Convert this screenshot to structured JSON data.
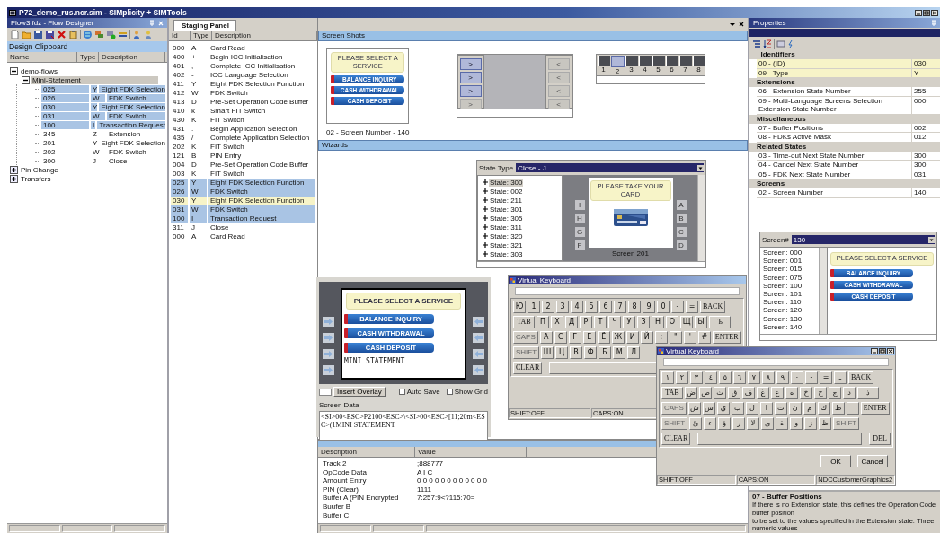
{
  "app_title": "P72_demo_rus.ncr.sim - SIMplicity + SIMTools",
  "flow_designer": {
    "title": "Flow3.fdz - Flow Designer",
    "clipboard_title": "Design Clipboard",
    "columns": [
      "Name",
      "Type",
      "Description"
    ],
    "tree": [
      {
        "name": "demo-flows",
        "expanded": true,
        "selected": false,
        "children": [
          {
            "name": "Mini-Statement",
            "expanded": true,
            "selected": true,
            "children": [
              {
                "name": "025",
                "type": "Y",
                "description": "Eight FDK Selection",
                "selected": true
              },
              {
                "name": "026",
                "type": "W",
                "description": "FDK Switch",
                "selected": true
              },
              {
                "name": "030",
                "type": "Y",
                "description": "Eight FDK Selection",
                "selected": true
              },
              {
                "name": "031",
                "type": "W",
                "description": "FDK Switch",
                "selected": true
              },
              {
                "name": "100",
                "type": "I",
                "description": "Transaction Request",
                "selected": true
              },
              {
                "name": "345",
                "type": "Z",
                "description": "Extension",
                "selected": false
              },
              {
                "name": "201",
                "type": "Y",
                "description": "Eight FDK Selection",
                "selected": false
              },
              {
                "name": "202",
                "type": "W",
                "description": "FDK Switch",
                "selected": false
              },
              {
                "name": "300",
                "type": "J",
                "description": "Close",
                "selected": false
              }
            ]
          }
        ]
      },
      {
        "name": "Pin Change",
        "expanded": false,
        "selected": false
      },
      {
        "name": "Transfers",
        "expanded": false,
        "selected": false
      }
    ]
  },
  "staging": {
    "tab": "Staging Panel",
    "columns": [
      "Id",
      "Type",
      "Description"
    ],
    "rows": [
      {
        "id": "000",
        "type": "A",
        "description": "Card Read",
        "selected": false,
        "current": false
      },
      {
        "id": "400",
        "type": "+",
        "description": "Begin ICC Initialisation",
        "selected": false,
        "current": false
      },
      {
        "id": "401",
        "type": ",",
        "description": "Complete ICC Initialisation",
        "selected": false,
        "current": false
      },
      {
        "id": "402",
        "type": "-",
        "description": "ICC Language Selection",
        "selected": false,
        "current": false
      },
      {
        "id": "411",
        "type": "Y",
        "description": "Eight FDK Selection Function",
        "selected": false,
        "current": false
      },
      {
        "id": "412",
        "type": "W",
        "description": "FDK Switch",
        "selected": false,
        "current": false
      },
      {
        "id": "413",
        "type": "D",
        "description": "Pre-Set Operation Code Buffer",
        "selected": false,
        "current": false
      },
      {
        "id": "410",
        "type": "k",
        "description": "Smart FIT Switch",
        "selected": false,
        "current": false
      },
      {
        "id": "430",
        "type": "K",
        "description": "FIT Switch",
        "selected": false,
        "current": false
      },
      {
        "id": "431",
        "type": ".",
        "description": "Begin Application Selection",
        "selected": false,
        "current": false
      },
      {
        "id": "435",
        "type": "/",
        "description": "Complete Application Selection",
        "selected": false,
        "current": false
      },
      {
        "id": "202",
        "type": "K",
        "description": "FIT Switch",
        "selected": false,
        "current": false
      },
      {
        "id": "121",
        "type": "B",
        "description": "PIN Entry",
        "selected": false,
        "current": false
      },
      {
        "id": "004",
        "type": "D",
        "description": "Pre-Set Operation Code Buffer",
        "selected": false,
        "current": false
      },
      {
        "id": "003",
        "type": "K",
        "description": "FIT Switch",
        "selected": false,
        "current": false
      },
      {
        "id": "025",
        "type": "Y",
        "description": "Eight FDK Selection Function",
        "selected": true,
        "current": false
      },
      {
        "id": "026",
        "type": "W",
        "description": "FDK Switch",
        "selected": true,
        "current": false
      },
      {
        "id": "030",
        "type": "Y",
        "description": "Eight FDK Selection Function",
        "selected": true,
        "current": true
      },
      {
        "id": "031",
        "type": "W",
        "description": "FDK Switch",
        "selected": true,
        "current": false
      },
      {
        "id": "100",
        "type": "I",
        "description": "Transaction Request",
        "selected": true,
        "current": false
      },
      {
        "id": "311",
        "type": "J",
        "description": "Close",
        "selected": false,
        "current": false
      },
      {
        "id": "000",
        "type": "A",
        "description": "Card Read",
        "selected": false,
        "current": false
      }
    ]
  },
  "screen_shots": {
    "title": "Screen Shots",
    "screen": {
      "prompt": "PLEASE SELECT A SERVICE",
      "buttons": [
        "BALANCE INQUIRY",
        "CASH WITHDRAWAL",
        "CASH DEPOSIT"
      ],
      "caption": "02 - Screen Number - 140"
    },
    "fdk_left": [
      {
        "label": ">",
        "active": true
      },
      {
        "label": ">",
        "active": true
      },
      {
        "label": ">",
        "active": true
      },
      {
        "label": ">",
        "active": false
      }
    ],
    "fdk_right": [
      {
        "label": "<",
        "active": false
      },
      {
        "label": "<",
        "active": false
      },
      {
        "label": "<",
        "active": false
      },
      {
        "label": "<",
        "active": false
      }
    ],
    "positions": [
      {
        "label": "1",
        "selected": false
      },
      {
        "label": "2",
        "selected": true
      },
      {
        "label": "3",
        "selected": false
      },
      {
        "label": "4",
        "selected": false
      },
      {
        "label": "5",
        "selected": false
      },
      {
        "label": "6",
        "selected": false
      },
      {
        "label": "7",
        "selected": false
      },
      {
        "label": "8",
        "selected": false
      }
    ]
  },
  "wizards": {
    "title": "Wizards"
  },
  "state_wizard": {
    "label": "State Type",
    "value": "Close - J",
    "states": [
      {
        "label": "State: 300",
        "selected": true
      },
      {
        "label": "State: 002",
        "selected": false
      },
      {
        "label": "State: 211",
        "selected": false
      },
      {
        "label": "State: 301",
        "selected": false
      },
      {
        "label": "State: 305",
        "selected": false
      },
      {
        "label": "State: 311",
        "selected": false
      },
      {
        "label": "State: 320",
        "selected": false
      },
      {
        "label": "State: 321",
        "selected": false
      },
      {
        "label": "State: 303",
        "selected": false
      }
    ],
    "prompt": "PLEASE TAKE YOUR CARD",
    "left_fdks": [
      "I",
      "H",
      "G",
      "F"
    ],
    "right_fdks": [
      "A",
      "B",
      "C",
      "D"
    ],
    "caption": "Screen 201"
  },
  "atm_editor": {
    "prompt": "PLEASE SELECT A SERVICE",
    "buttons": [
      "BALANCE INQUIRY",
      "CASH WITHDRAWAL",
      "CASH DEPOSIT"
    ],
    "footer": "MINI STATEMENT",
    "overlay_button": "Insert Overlay",
    "options": [
      {
        "label": "Auto Save",
        "checked": false
      },
      {
        "label": "Show Grid",
        "checked": false
      }
    ],
    "data_label": "Screen Data",
    "data": "<SI>00<ESC>P2100<ESC>\\<SI>00<ESC>[11;20m<ESC>(1MINI STATEMENT"
  },
  "keyboard_russian": {
    "title": "Virtual Keyboard",
    "rows": [
      {
        "keys": [
          {
            "label": "Ю",
            "kind": "char"
          },
          {
            "label": "1",
            "kind": "char"
          },
          {
            "label": "2",
            "kind": "char"
          },
          {
            "label": "3",
            "kind": "char"
          },
          {
            "label": "4",
            "kind": "char"
          },
          {
            "label": "5",
            "kind": "char"
          },
          {
            "label": "6",
            "kind": "char"
          },
          {
            "label": "7",
            "kind": "char"
          },
          {
            "label": "8",
            "kind": "char"
          },
          {
            "label": "9",
            "kind": "char"
          },
          {
            "label": "0",
            "kind": "char"
          },
          {
            "label": "-",
            "kind": "char"
          },
          {
            "label": "=",
            "kind": "char"
          },
          {
            "label": "BACK",
            "kind": "func"
          }
        ]
      },
      {
        "keys": [
          {
            "label": "TAB",
            "kind": "func"
          },
          {
            "label": "П",
            "kind": "char"
          },
          {
            "label": "Х",
            "kind": "char"
          },
          {
            "label": "Д",
            "kind": "char"
          },
          {
            "label": "Р",
            "kind": "char"
          },
          {
            "label": "Т",
            "kind": "char"
          },
          {
            "label": "Ч",
            "kind": "char"
          },
          {
            "label": "У",
            "kind": "char"
          },
          {
            "label": "З",
            "kind": "char"
          },
          {
            "label": "Н",
            "kind": "char"
          },
          {
            "label": "О",
            "kind": "char"
          },
          {
            "label": "Щ",
            "kind": "char"
          },
          {
            "label": "Ы",
            "kind": "char"
          },
          {
            "label": "Ъ",
            "kind": "func"
          }
        ]
      },
      {
        "keys": [
          {
            "label": "CAPS",
            "kind": "toggle"
          },
          {
            "label": "А",
            "kind": "char"
          },
          {
            "label": "С",
            "kind": "char"
          },
          {
            "label": "Г",
            "kind": "char"
          },
          {
            "label": "Е",
            "kind": "char"
          },
          {
            "label": "Ё",
            "kind": "char"
          },
          {
            "label": "Ж",
            "kind": "char"
          },
          {
            "label": "И",
            "kind": "char"
          },
          {
            "label": "Й",
            "kind": "char"
          },
          {
            "label": ";",
            "kind": "char"
          },
          {
            "label": "\"",
            "kind": "char"
          },
          {
            "label": "'",
            "kind": "char"
          },
          {
            "label": "#",
            "kind": "char"
          },
          {
            "label": "ENTER",
            "kind": "func"
          }
        ]
      },
      {
        "keys": [
          {
            "label": "SHIFT",
            "kind": "toggle"
          },
          {
            "label": "Ш",
            "kind": "char"
          },
          {
            "label": "Ц",
            "kind": "char"
          },
          {
            "label": "В",
            "kind": "char"
          },
          {
            "label": "Ф",
            "kind": "char"
          },
          {
            "label": "Б",
            "kind": "char"
          },
          {
            "label": "М",
            "kind": "char"
          },
          {
            "label": "Л",
            "kind": "char"
          }
        ]
      },
      {
        "keys": [
          {
            "label": "CLEAR",
            "kind": "func"
          },
          {
            "kind": "space"
          }
        ]
      }
    ],
    "status": [
      "SHIFT:OFF",
      "CAPS:ON"
    ]
  },
  "screen_picker": {
    "label": "Screen#",
    "value": "130",
    "screens": [
      "Screen: 000",
      "Screen: 001",
      "Screen: 015",
      "Screen: 075",
      "Screen: 100",
      "Screen: 101",
      "Screen: 110",
      "Screen: 120",
      "Screen: 130",
      "Screen: 140"
    ],
    "prompt": "PLEASE SELECT A SERVICE",
    "buttons": [
      "BALANCE INQUIRY",
      "CASH WITHDRAWAL",
      "CASH DEPOSIT"
    ]
  },
  "keyboard_arabic": {
    "title": "Virtual Keyboard",
    "rows": [
      {
        "kind": "rtl",
        "keys": [
          {
            "label": "BACK",
            "kind": "func"
          },
          {
            "label": "ـ",
            "kind": "char"
          },
          {
            "label": "=",
            "kind": "char"
          },
          {
            "label": "-",
            "kind": "char"
          },
          {
            "label": "٠",
            "kind": "char"
          },
          {
            "label": "٩",
            "kind": "char"
          },
          {
            "label": "٨",
            "kind": "char"
          },
          {
            "label": "٧",
            "kind": "char"
          },
          {
            "label": "٦",
            "kind": "char"
          },
          {
            "label": "٥",
            "kind": "char"
          },
          {
            "label": "٤",
            "kind": "char"
          },
          {
            "label": "٣",
            "kind": "char"
          },
          {
            "label": "٢",
            "kind": "char"
          },
          {
            "label": "١",
            "kind": "char"
          }
        ]
      },
      {
        "kind": "rtl",
        "keys": [
          {
            "label": "ذ",
            "kind": "func"
          },
          {
            "label": "د",
            "kind": "char"
          },
          {
            "label": "ج",
            "kind": "char"
          },
          {
            "label": "ح",
            "kind": "char"
          },
          {
            "label": "خ",
            "kind": "char"
          },
          {
            "label": "ه",
            "kind": "char"
          },
          {
            "label": "ع",
            "kind": "char"
          },
          {
            "label": "غ",
            "kind": "char"
          },
          {
            "label": "ف",
            "kind": "char"
          },
          {
            "label": "ق",
            "kind": "char"
          },
          {
            "label": "ث",
            "kind": "char"
          },
          {
            "label": "ص",
            "kind": "char"
          },
          {
            "label": "ض",
            "kind": "char"
          },
          {
            "label": "TAB",
            "kind": "func"
          }
        ]
      },
      {
        "kind": "rtl",
        "keys": [
          {
            "label": "ENTER",
            "kind": "func"
          },
          {
            "kind": "blank"
          },
          {
            "label": "ط",
            "kind": "char"
          },
          {
            "label": "ك",
            "kind": "char"
          },
          {
            "label": "م",
            "kind": "char"
          },
          {
            "label": "ن",
            "kind": "char"
          },
          {
            "label": "ت",
            "kind": "char"
          },
          {
            "label": "ا",
            "kind": "char"
          },
          {
            "label": "ل",
            "kind": "char"
          },
          {
            "label": "ب",
            "kind": "char"
          },
          {
            "label": "ي",
            "kind": "char"
          },
          {
            "label": "س",
            "kind": "char"
          },
          {
            "label": "ش",
            "kind": "char"
          },
          {
            "label": "CAPS",
            "kind": "toggle"
          }
        ]
      },
      {
        "kind": "rtl",
        "keys": [
          {
            "label": "SHIFT",
            "kind": "toggle"
          },
          {
            "label": "ظ",
            "kind": "char"
          },
          {
            "label": "ز",
            "kind": "char"
          },
          {
            "label": "و",
            "kind": "char"
          },
          {
            "label": "ة",
            "kind": "char"
          },
          {
            "label": "ى",
            "kind": "char"
          },
          {
            "label": "لا",
            "kind": "char"
          },
          {
            "label": "ر",
            "kind": "char"
          },
          {
            "label": "ؤ",
            "kind": "char"
          },
          {
            "label": "ء",
            "kind": "char"
          },
          {
            "label": "ئ",
            "kind": "char"
          },
          {
            "label": "SHIFT",
            "kind": "toggle"
          }
        ]
      },
      {
        "kind": "ltr",
        "keys": [
          {
            "label": "CLEAR",
            "kind": "func"
          },
          {
            "kind": "space"
          },
          {
            "label": "DEL",
            "kind": "func"
          }
        ]
      }
    ],
    "buttons": [
      "OK",
      "Cancel"
    ],
    "status": [
      "SHIFT:OFF",
      "CAPS:ON",
      "NDCCustomerGraphics2"
    ]
  },
  "trace": {
    "columns": [
      "Description",
      "Value"
    ],
    "rows": [
      {
        "description": "Track 2",
        "value": ";888777"
      },
      {
        "description": "OpCode Data",
        "value": "A I C _ _ _ _ _"
      },
      {
        "description": "Amount Entry",
        "value": "0 0 0 0 0 0 0 0 0 0 0 0"
      },
      {
        "description": "PIN (Clear)",
        "value": "1111"
      },
      {
        "description": "Buffer A (PIN Encrypted",
        "value": "7:257:9<?115:70="
      },
      {
        "description": "Buufer B"
      },
      {
        "description": "Buffer C"
      }
    ]
  },
  "properties": {
    "title": "Properties",
    "categories": [
      {
        "name": "_Identifiers",
        "rows": [
          {
            "name": "00 - (ID)",
            "value": "030",
            "selected": true
          },
          {
            "name": "09 - Type",
            "value": "Y",
            "selected": true
          }
        ]
      },
      {
        "name": "Extensions",
        "rows": [
          {
            "name": "06 - Extension State Number",
            "value": "255",
            "selected": false
          },
          {
            "name": "09 - Multi-Language Screens Selection Extension State Number",
            "value": "000",
            "selected": false
          }
        ]
      },
      {
        "name": "Miscellaneous",
        "rows": [
          {
            "name": "07 - Buffer Positions",
            "value": "002",
            "selected": false
          },
          {
            "name": "08 - FDKs Active Mask",
            "value": "012",
            "selected": false
          }
        ]
      },
      {
        "name": "Related States",
        "rows": [
          {
            "name": "03 - Time-out Next State Number",
            "value": "300",
            "selected": false
          },
          {
            "name": "04 - Cancel Next State Number",
            "value": "300",
            "selected": false
          },
          {
            "name": "05 - FDK Next State Number",
            "value": "031",
            "selected": false
          }
        ]
      },
      {
        "name": "Screens",
        "rows": [
          {
            "name": "02 - Screen Number",
            "value": "140",
            "selected": false
          }
        ]
      }
    ],
    "help_title": "07 - Buffer Positions",
    "help_lines": [
      "If there is no Extension state, this defines the Operation Code buffer position",
      "to be set to the values specified in the Extension state. Three numeric values"
    ]
  }
}
